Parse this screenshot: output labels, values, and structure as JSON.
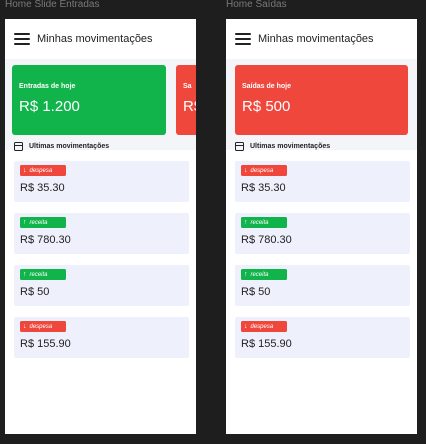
{
  "frames": [
    {
      "frame_title": "Home Slide Entradas",
      "header_title": "Minhas movimentações",
      "cards": [
        {
          "label": "Entradas de hoje",
          "value": "R$ 1.200",
          "color": "#11b34b"
        },
        {
          "label": "Sa",
          "value": "R$",
          "color": "#f0473d"
        }
      ],
      "section_title": "Ultimas movimentações",
      "items": [
        {
          "type": "despesa",
          "arrow": "↓",
          "badge": "despesa",
          "amount": "R$ 35.30"
        },
        {
          "type": "receita",
          "arrow": "↑",
          "badge": "receita",
          "amount": "R$ 780.30"
        },
        {
          "type": "receita",
          "arrow": "↑",
          "badge": "receita",
          "amount": "R$ 50"
        },
        {
          "type": "despesa",
          "arrow": "↓",
          "badge": "despesa",
          "amount": "R$ 155.90"
        }
      ]
    },
    {
      "frame_title": "Home Saídas",
      "header_title": "Minhas movimentações",
      "cards": [
        {
          "label": "Saídas de hoje",
          "value": "R$ 500",
          "color": "#f0473d"
        }
      ],
      "section_title": "Ultimas movimentações",
      "items": [
        {
          "type": "despesa",
          "arrow": "↓",
          "badge": "despesa",
          "amount": "R$ 35.30"
        },
        {
          "type": "receita",
          "arrow": "↑",
          "badge": "receita",
          "amount": "R$ 780.30"
        },
        {
          "type": "receita",
          "arrow": "↑",
          "badge": "receita",
          "amount": "R$ 50"
        },
        {
          "type": "despesa",
          "arrow": "↓",
          "badge": "despesa",
          "amount": "R$ 155.90"
        }
      ]
    }
  ]
}
